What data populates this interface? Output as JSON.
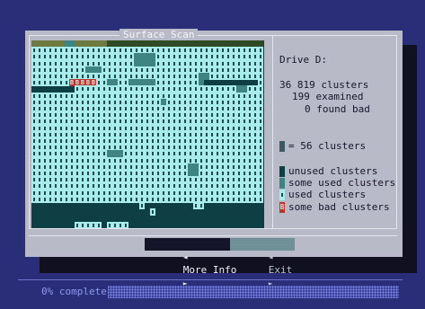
{
  "dialog": {
    "title": "Surface Scan",
    "drive_label": "Drive D:",
    "clusters_line": "36 819 clusters",
    "examined_line": "199 examined",
    "found_bad_line": "0 found bad"
  },
  "legend": {
    "block_label": "= 56 clusters",
    "unused_label": "unused clusters",
    "some_used_label": "some used clusters",
    "used_label": "used clusters",
    "bad_label": "some bad clusters",
    "bad_glyph": "B"
  },
  "buttons": {
    "more_info": "More Info",
    "exit": "Exit",
    "arrow_left": "◄",
    "arrow_right": "►"
  },
  "status": {
    "text": "0% complete",
    "progress_fraction": 0
  },
  "colors": {
    "used": "#a8ecec",
    "some_used": "#3d8482",
    "unused": "#0d3f44",
    "bad": "#b5372f",
    "background": "#2a2e78"
  },
  "cluster_map": {
    "legend": {
      "U": "used",
      "S": "some-used",
      ".": "unused",
      "B": "bad",
      "H": "header",
      "h": "header-dark"
    },
    "rows": [
      "HHHHHHSSHHHHHHhhhhhhhhhhhhhhhhhhhhhhhhhhhhh",
      "UUUUUUUUUUUUUUUUUUUUUUUUUUUUUUUUUUUUUUUUUUU",
      "UUUUUUUUUUUUUUUUUUUSSSSUUUUUUUUUUUUUUUUUUUU",
      "UUUUUUUUUUUUUUUUUUUSSSSUUUUUUUUUUUUUUUUUUUU",
      "UUUUUUUUUUSSSUUUUUUUUUUUUUUUUUUUUUUUUUUUUUU",
      "UUUUUUUUUUUUUUUUUUUUUUUUUUUUUUUSSUUUUUUUUUU",
      "UUUUUUUBBBBBUUSSUUSSSSSUUUUUUUUS..........U",
      "........UUUUUUUUUUUUUUUUUUUUUUUUUUUUUUSSUUU",
      "UUUUUUUUUUUUUUUUUUUUUUUUUUUUUUUUUUUUUUUUUUU",
      "UUUUUUUUUUUUUUUUUUUUUUUUSUUUUUUUUUUUUUUUUUU",
      "UUUUUUUUUUUUUUUUUUUUUUUUUUUUUUUUUUUUUUUUUUU",
      "UUUUUUUUUUUUUUUUUUUUUUUUUUUUUUUUUUUUUUUUUUU",
      "UUUUUUUUUUUUUUUUUUUUUUUUUUUUUUUUUUUUUUUUUUU",
      "UUUUUUUUUUUUUUUUUUUUUUUUUUUUUUUUUUUUUUUUUUU",
      "UUUUUUUUUUUUUUUUUUUUUUUUUUUUUUUUUUUUUUUUUUU",
      "UUUUUUUUUUUUUUUUUUUUUUUUUUUUUUUUUUUUUUUUUUU",
      "UUUUUUUUUUUUUUUUUUUUUUUUUUUUUUUUUUUUUUUUUUU",
      "UUUUUUUUUUUUUUSSSUUUUUUUUUUUUUUUUUUUUUUUUUU",
      "UUUUUUUUUUUUUUUUUUUUUUUUUUUUUUUUUUUUUUUUUUU",
      "UUUUUUUUUUUUUUUUUUUUUUUUUUUUUSSUUUUUUUUUUUU",
      "UUUUUUUUUUUUUUUUUUUUUUUUUUUUUSSUUUUUUUUUUUU",
      "UUUUUUUUUUUUUUUUUUUUUUUUUUUUUUUUUUUUUUUUUUU",
      "UUUUUUUUUUUUUUUUUUUUUUUUUUUUUUUUUUUUUUUUUUU",
      "UUUUUUUUUUUUUUUUUUUUUUUUUUUUUUUUUUUUUUUUUUU",
      "UUUUUUUUUUUUUUUUUUUUUUUUUUUUUUUUUUUUUUUUUUU",
      "....................U.........UU............",
      "......................U.....................",
      "...........................................",
      "........UUUUU.UUUU........................."
    ]
  }
}
